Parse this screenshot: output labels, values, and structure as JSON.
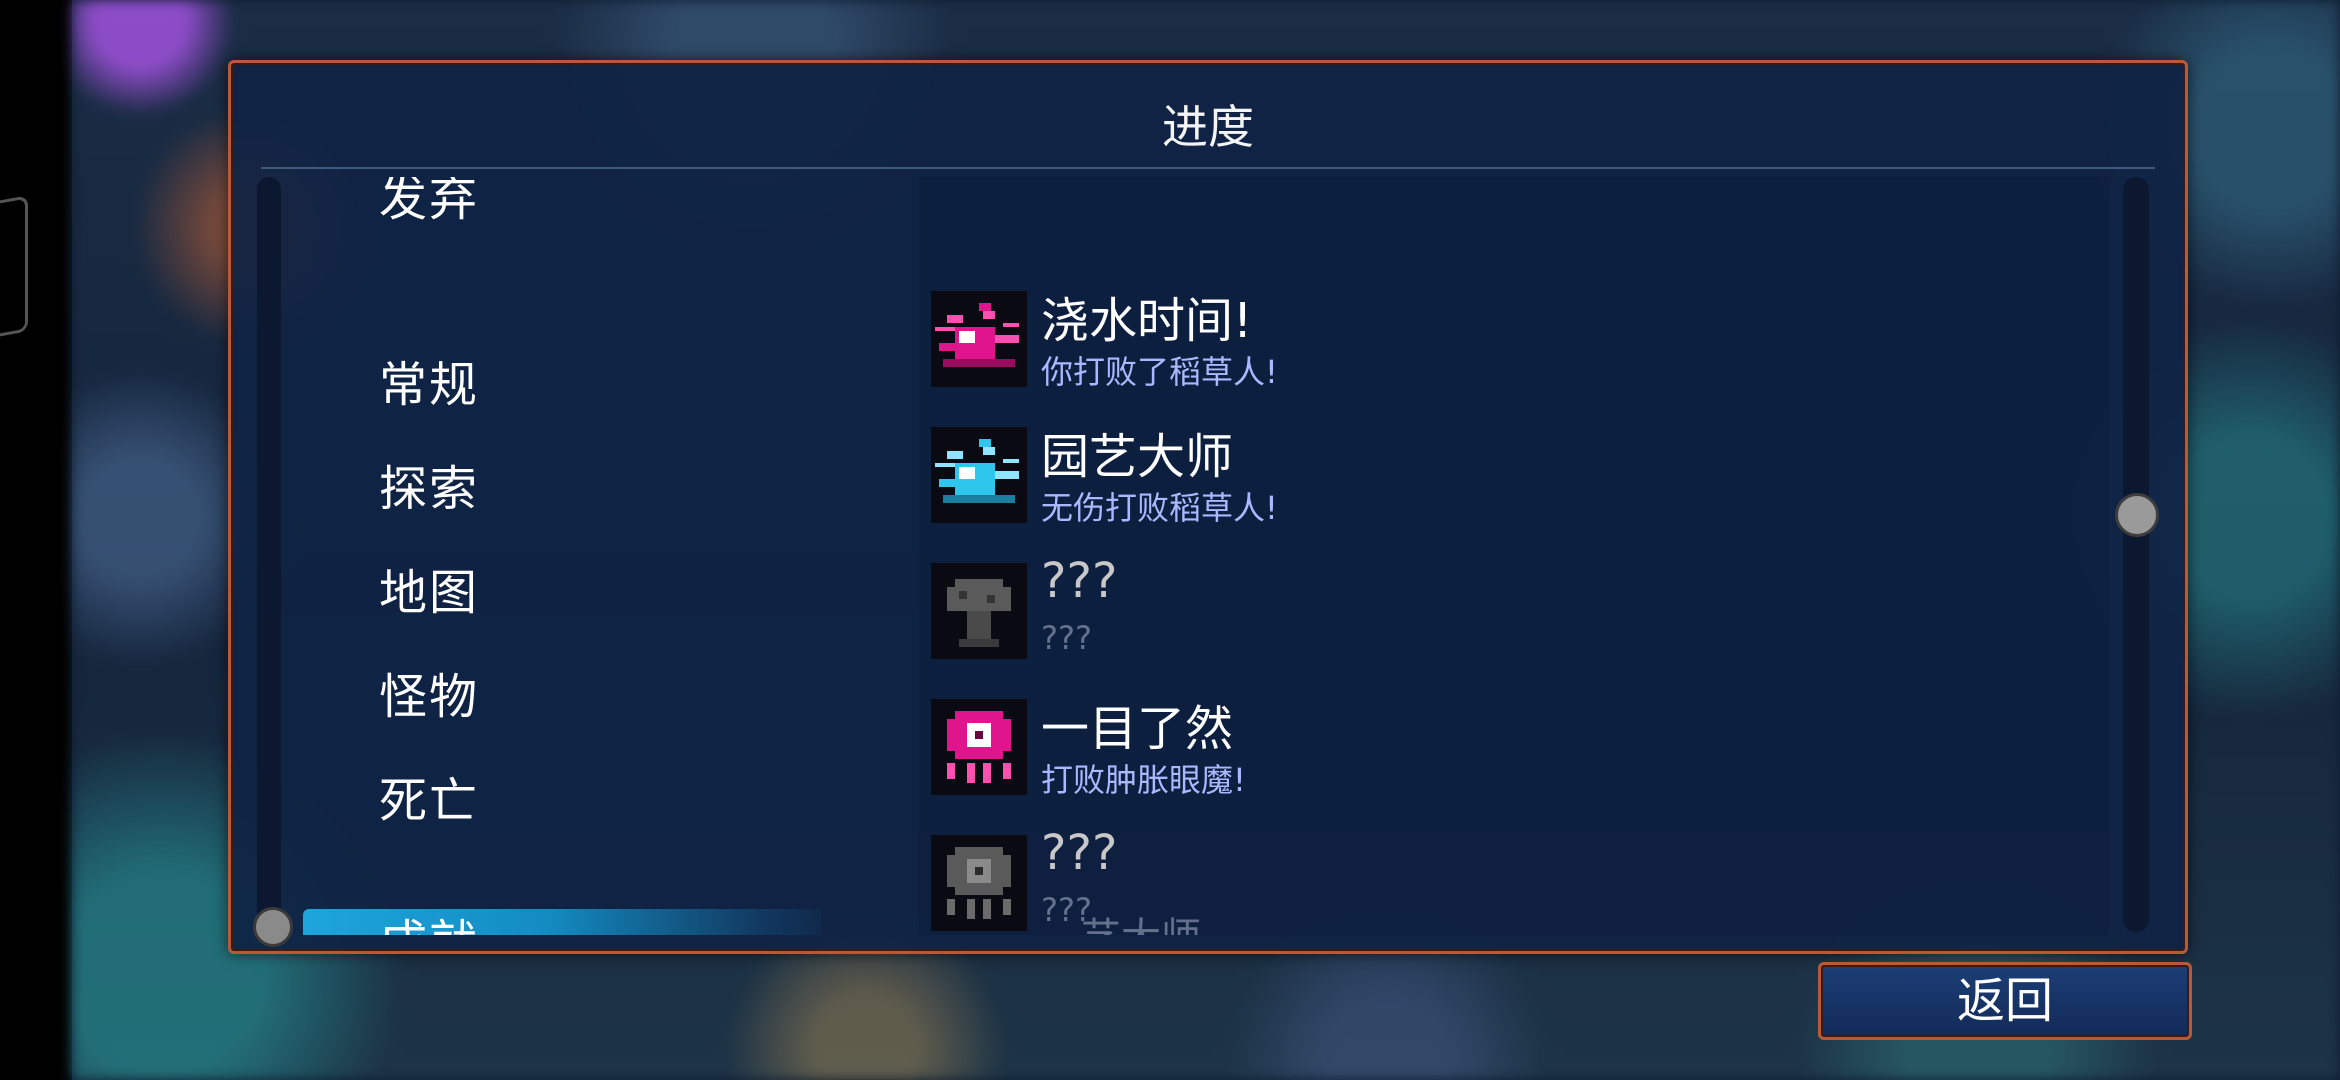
{
  "panel": {
    "title": "进度"
  },
  "categories": {
    "partial_top": "发弃",
    "items": [
      {
        "label": "常规"
      },
      {
        "label": "探索"
      },
      {
        "label": "地图"
      },
      {
        "label": "怪物"
      },
      {
        "label": "死亡"
      },
      {
        "label": "成就",
        "selected": true
      }
    ]
  },
  "achievements": {
    "items": [
      {
        "title": "浇水时间!",
        "desc": "你打败了稻草人!",
        "unlocked": true,
        "icon": "watering-can-magenta-icon"
      },
      {
        "title": "园艺大师",
        "desc": "无伤打败稻草人!",
        "unlocked": true,
        "icon": "watering-can-cyan-icon"
      },
      {
        "title": "???",
        "desc": "???",
        "unlocked": false,
        "icon": "locked-mushroom-icon"
      },
      {
        "title": "一目了然",
        "desc": "打败肿胀眼魔!",
        "unlocked": true,
        "icon": "eye-monster-magenta-icon"
      },
      {
        "title": "???",
        "desc": "???",
        "unlocked": false,
        "icon": "locked-eye-monster-icon"
      }
    ],
    "partial_bottom": "…艺大师"
  },
  "footer": {
    "back_label": "返回"
  },
  "colors": {
    "panel_border": "#b85a3a",
    "selected_highlight": "#1da6dc",
    "unlocked_desc": "#a9b8ff",
    "locked_text": "#65728c",
    "icon_magenta": "#e0148c",
    "icon_cyan": "#2fc6ee"
  }
}
